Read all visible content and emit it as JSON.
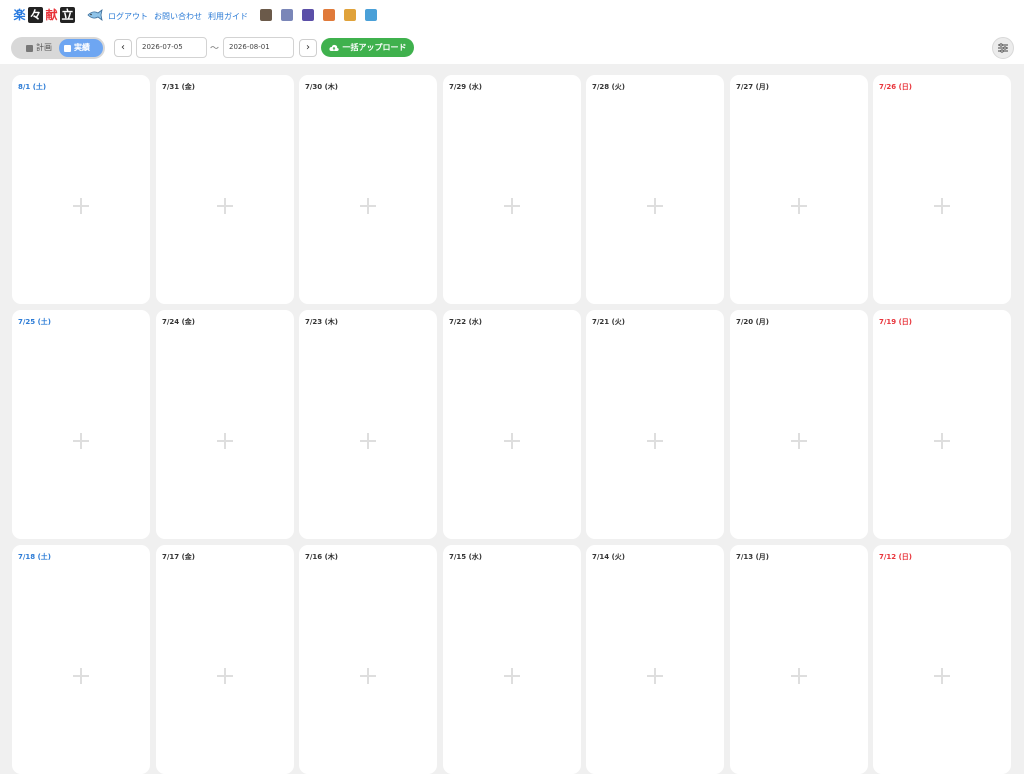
{
  "logo": {
    "chars": [
      "楽",
      "々",
      "献",
      "立"
    ]
  },
  "header": {
    "links": [
      "ログアウト",
      "お問い合わせ",
      "利用ガイド"
    ],
    "apps": [
      {
        "icon": "rice-bowl-icon",
        "color": "#6b5a4a"
      },
      {
        "icon": "calendar-icon",
        "color": "#7a86b8"
      },
      {
        "icon": "book-icon",
        "color": "#5b4fa8"
      },
      {
        "icon": "fire-icon",
        "color": "#e07a3a"
      },
      {
        "icon": "scroll-icon",
        "color": "#e0a23a"
      },
      {
        "icon": "notebook-icon",
        "color": "#4aa0d8"
      }
    ]
  },
  "toolbar": {
    "mode_plan": "計画",
    "mode_actual": "実績",
    "start_date": "2026-07-05",
    "end_date": "2026-08-01",
    "range_sep": "～",
    "prev": "‹",
    "next": "›",
    "upload_label": "一括アップロード"
  },
  "rows": [
    [
      "8/1 (土)",
      "7/31 (金)",
      "7/30 (木)",
      "7/29 (水)",
      "7/28 (火)",
      "7/27 (月)",
      "7/26 (日)"
    ],
    [
      "7/25 (土)",
      "7/24 (金)",
      "7/23 (木)",
      "7/22 (水)",
      "7/21 (火)",
      "7/20 (月)",
      "7/19 (日)"
    ],
    [
      "7/18 (土)",
      "7/17 (金)",
      "7/16 (木)",
      "7/15 (水)",
      "7/14 (火)",
      "7/13 (月)",
      "7/12 (日)"
    ]
  ]
}
